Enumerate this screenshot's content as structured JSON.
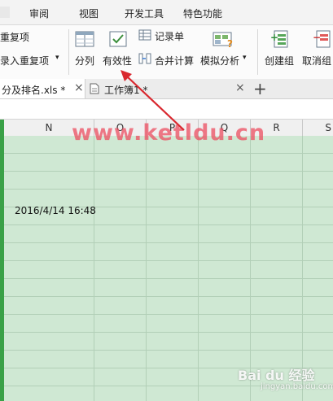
{
  "menu": {
    "items": [
      "审阅",
      "视图",
      "开发工具",
      "特色功能"
    ]
  },
  "ribbon": {
    "highlight_dup": "重复项",
    "reject_dup": "录入重复项",
    "split": "分列",
    "validity": "有效性",
    "record": "记录单",
    "consolidate": "合并计算",
    "whatif": "模拟分析",
    "group": "创建组",
    "ungroup": "取消组"
  },
  "tabs": [
    {
      "label": "分及排名.xls *",
      "close": "×"
    },
    {
      "label": "工作簿1 *",
      "close": "×"
    }
  ],
  "new_tab": "+",
  "columns": [
    "N",
    "O",
    "P",
    "Q",
    "R",
    "S"
  ],
  "cell_value": "2016/4/14 16:48",
  "watermark": "www.ketldu.cn",
  "baidu_logo": "Bai du 经验",
  "baidu_url": "jingyan.baidu.com",
  "colors": {
    "sheet_bg": "#cfe8d3",
    "watermark": "#ec4e60",
    "arrow": "#d9272e",
    "selection_bar": "#3aa147"
  }
}
